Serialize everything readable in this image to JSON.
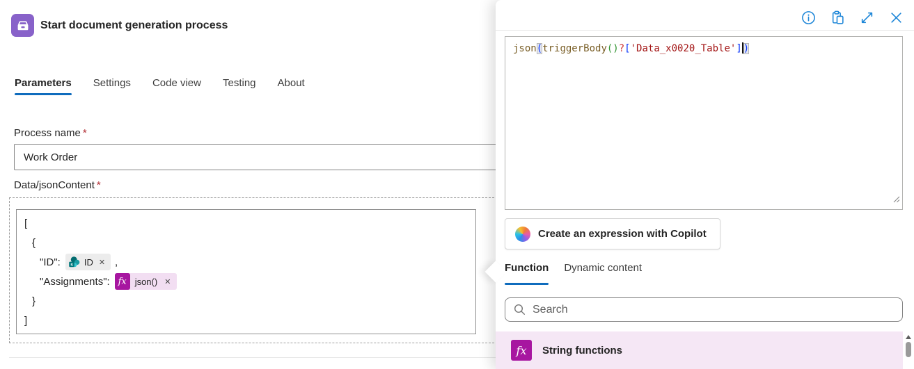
{
  "colors": {
    "accent_blue": "#0f6cbd",
    "toolbar_icon_blue": "#1f87d8",
    "action_icon_purple": "#8862c9",
    "expression_magenta": "#a716a0",
    "function_row_pink": "#f5e7f5",
    "required_red": "#b02a30",
    "code_function": "#795e26",
    "code_string": "#a31515",
    "code_bracket": "#0431fa",
    "code_inner_paren": "#319331",
    "code_operator": "#cd3131"
  },
  "action": {
    "title": "Start document generation process",
    "icon": "archive-drawer-icon"
  },
  "tabs": [
    {
      "label": "Parameters",
      "active": true
    },
    {
      "label": "Settings",
      "active": false
    },
    {
      "label": "Code view",
      "active": false
    },
    {
      "label": "Testing",
      "active": false
    },
    {
      "label": "About",
      "active": false
    }
  ],
  "fields": {
    "process_name": {
      "label": "Process name",
      "required_marker": "*",
      "value": "Work Order"
    },
    "data_json_content": {
      "label": "Data/jsonContent",
      "required_marker": "*",
      "lines": {
        "open_bracket": "[",
        "open_brace": "{",
        "id_key": "\"ID\":",
        "comma": ",",
        "assignments_key": "\"Assignments\":",
        "close_brace": "}",
        "close_bracket": "]"
      },
      "pills": {
        "id": {
          "icon": "sharepoint-icon",
          "label": "ID",
          "remove": "✕"
        },
        "json": {
          "icon": "fx-icon",
          "fx": "fx",
          "label": "json()",
          "remove": "✕"
        }
      }
    }
  },
  "panel": {
    "toolbar": {
      "icons": [
        "info-icon",
        "paste-icon",
        "expand-icon",
        "close-icon"
      ]
    },
    "expression": {
      "full_text": "json(triggerBody()?['Data_x0020_Table'])",
      "tokens": [
        {
          "text": "json",
          "style": "function"
        },
        {
          "text": "(",
          "style": "paren-match"
        },
        {
          "text": "triggerBody",
          "style": "function"
        },
        {
          "text": "()",
          "style": "inner-paren"
        },
        {
          "text": "?",
          "style": "operator"
        },
        {
          "text": "[",
          "style": "bracket"
        },
        {
          "text": "'Data_x0020_Table'",
          "style": "string"
        },
        {
          "text": "]",
          "style": "bracket"
        },
        {
          "text": ")",
          "style": "paren-match"
        }
      ]
    },
    "copilot_button": {
      "icon": "copilot-logo",
      "label": "Create an expression with Copilot"
    },
    "tabs": [
      {
        "label": "Function",
        "active": true
      },
      {
        "label": "Dynamic content",
        "active": false
      }
    ],
    "search": {
      "icon": "search-icon",
      "placeholder": "Search"
    },
    "list": [
      {
        "icon": "fx-icon",
        "fx": "fx",
        "label": "String functions"
      }
    ]
  }
}
